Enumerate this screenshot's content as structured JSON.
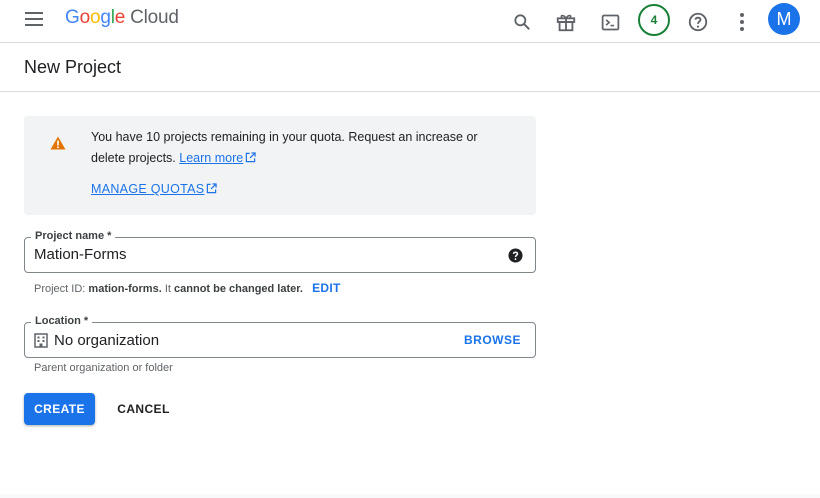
{
  "header": {
    "logo": {
      "g1": "G",
      "o1": "o",
      "o2": "o",
      "g2": "g",
      "l": "l",
      "e": "e",
      "product": "Cloud"
    },
    "notification_count": "4",
    "avatar_initial": "M",
    "icons": [
      "menu-icon",
      "search-icon",
      "gift-icon",
      "terminal-icon",
      "help-icon",
      "more-vert-icon"
    ]
  },
  "page": {
    "title": "New Project"
  },
  "quota": {
    "message": "You have 10 projects remaining in your quota. Request an increase or delete projects.",
    "learn_more": "Learn more",
    "manage_quotas": "MANAGE QUOTAS"
  },
  "project_name": {
    "label": "Project name *",
    "value": "Mation-Forms"
  },
  "project_id_hint": {
    "prefix": "Project ID:",
    "id": "mation-forms.",
    "middle": "It",
    "emphasis": "cannot be changed later.",
    "edit": "EDIT"
  },
  "location": {
    "label": "Location *",
    "value": "No organization",
    "browse": "BROWSE",
    "hint": "Parent organization or folder"
  },
  "actions": {
    "create": "CREATE",
    "cancel": "CANCEL"
  },
  "colors": {
    "primary": "#1a73e8",
    "warning": "#e37400",
    "notification": "#188038"
  }
}
